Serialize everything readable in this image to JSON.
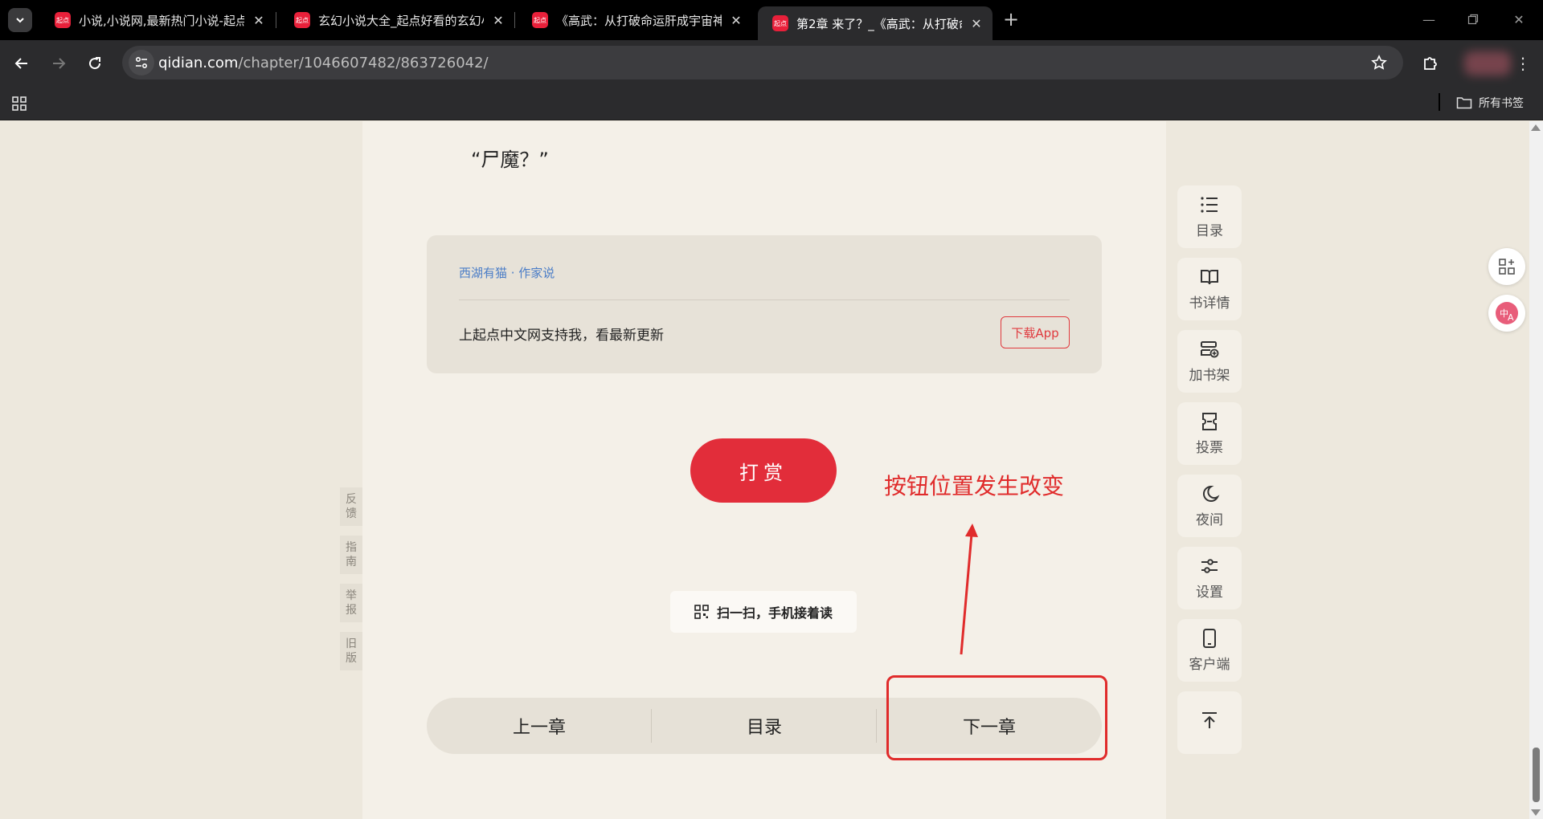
{
  "browser": {
    "tabs": [
      {
        "title": "小说,小说网,最新热门小说-起点",
        "favicon": "起点"
      },
      {
        "title": "玄幻小说大全_起点好看的玄幻小说",
        "favicon": "起点"
      },
      {
        "title": "《高武：从打破命运肝成宇宙神",
        "favicon": "起点"
      },
      {
        "title": "第2章 来了？_《高武：从打破命",
        "favicon": "起点"
      }
    ],
    "active_tab": 3,
    "url_host": "qidian.com",
    "url_path": "/chapter/1046607482/863726042/",
    "all_bookmarks_label": "所有书签"
  },
  "reader": {
    "quote": "“尸魔？”",
    "author_note": {
      "name": "西湖有猫 · 作家说",
      "message": "上起点中文网支持我，看最新更新",
      "download_label": "下载App"
    },
    "tip_label": "打赏",
    "scan_label": "扫一扫，手机接着读",
    "chapter_nav": {
      "prev": "上一章",
      "toc": "目录",
      "next": "下一章"
    }
  },
  "side_links": [
    "反馈",
    "指南",
    "举报",
    "旧版"
  ],
  "right_toolbar": [
    {
      "label": "目录",
      "icon": "list-icon"
    },
    {
      "label": "书详情",
      "icon": "book-icon"
    },
    {
      "label": "加书架",
      "icon": "add-shelf-icon"
    },
    {
      "label": "投票",
      "icon": "ticket-icon"
    },
    {
      "label": "夜间",
      "icon": "moon-icon"
    },
    {
      "label": "设置",
      "icon": "sliders-icon"
    },
    {
      "label": "客户端",
      "icon": "phone-icon"
    },
    {
      "label": "",
      "icon": "back-to-top-icon"
    }
  ],
  "annotation": {
    "text": "按钮位置发生改变",
    "color": "#e02b2b"
  },
  "colors": {
    "accent": "#e22d3a",
    "link": "#4b7dc7",
    "page_bg": "#ede8dd",
    "reader_bg": "#f4f0e8"
  }
}
